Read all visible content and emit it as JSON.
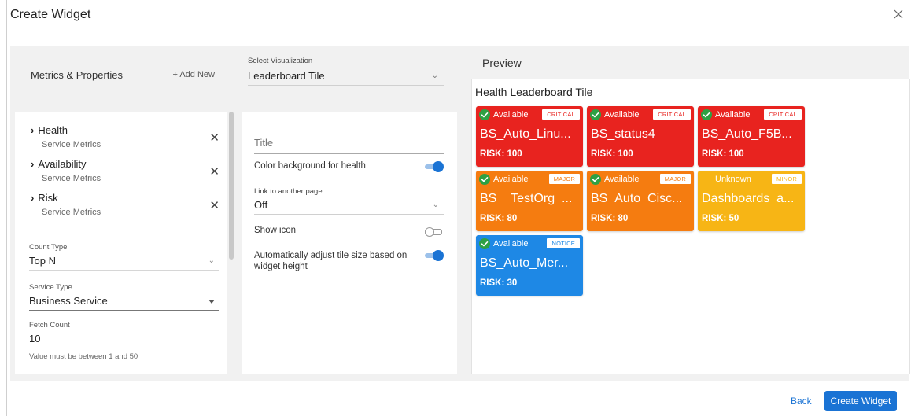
{
  "dialog": {
    "title": "Create Widget",
    "close_icon": "close-icon"
  },
  "metrics": {
    "header": "Metrics & Properties",
    "add_new": "+ Add New",
    "items": [
      {
        "name": "Health",
        "sub": "Service Metrics"
      },
      {
        "name": "Availability",
        "sub": "Service Metrics"
      },
      {
        "name": "Risk",
        "sub": "Service Metrics"
      }
    ],
    "count_type": {
      "label": "Count Type",
      "value": "Top N"
    },
    "service_type": {
      "label": "Service Type",
      "value": "Business Service"
    },
    "fetch_count": {
      "label": "Fetch Count",
      "value": "10",
      "hint": "Value must be between 1 and 50"
    }
  },
  "visualization": {
    "label": "Select Visualization",
    "value": "Leaderboard Tile",
    "title_placeholder": "Title",
    "color_bg_label": "Color background for health",
    "color_bg_on": true,
    "link_label": "Link to another page",
    "link_value": "Off",
    "show_icon_label": "Show icon",
    "show_icon_on": false,
    "auto_adjust_label": "Automatically adjust tile size based on widget height",
    "auto_adjust_on": true
  },
  "preview": {
    "header": "Preview",
    "subtitle": "Health Leaderboard Tile",
    "tiles": [
      {
        "status": "Available",
        "severity": "CRITICAL",
        "name": "BS_Auto_Linu...",
        "risk": "RISK: 100",
        "color": "#e8231f",
        "sev_color": "#e8231f",
        "check": true
      },
      {
        "status": "Available",
        "severity": "CRITICAL",
        "name": "BS_status4",
        "risk": "RISK: 100",
        "color": "#e8231f",
        "sev_color": "#e8231f",
        "check": true
      },
      {
        "status": "Available",
        "severity": "CRITICAL",
        "name": "BS_Auto_F5B...",
        "risk": "RISK: 100",
        "color": "#e8231f",
        "sev_color": "#e8231f",
        "check": true
      },
      {
        "status": "Available",
        "severity": "MAJOR",
        "name": "BS__TestOrg_...",
        "risk": "RISK: 80",
        "color": "#f57c10",
        "sev_color": "#f57c10",
        "check": true
      },
      {
        "status": "Available",
        "severity": "MAJOR",
        "name": "BS_Auto_Cisc...",
        "risk": "RISK: 80",
        "color": "#f57c10",
        "sev_color": "#f57c10",
        "check": true
      },
      {
        "status": "Unknown",
        "severity": "MINOR",
        "name": "Dashboards_a...",
        "risk": "RISK: 50",
        "color": "#f7b515",
        "sev_color": "#f7b515",
        "check": false
      },
      {
        "status": "Available",
        "severity": "NOTICE",
        "name": "BS_Auto_Mer...",
        "risk": "RISK: 30",
        "color": "#1e88e5",
        "sev_color": "#1e88e5",
        "check": true
      }
    ]
  },
  "footer": {
    "back": "Back",
    "create": "Create Widget"
  },
  "colors": {
    "accent": "#1a73d4",
    "critical": "#e8231f",
    "major": "#f57c10",
    "minor": "#f7b515",
    "notice": "#1e88e5",
    "available_check": "#2ea043"
  }
}
